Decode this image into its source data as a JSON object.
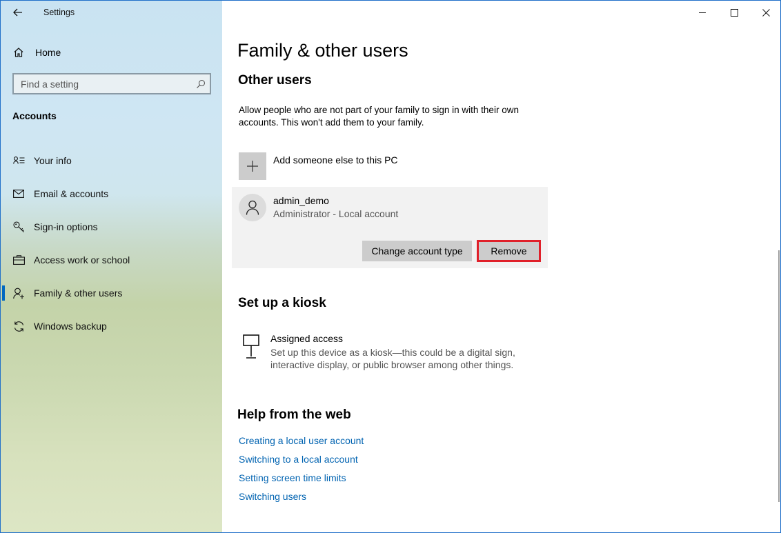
{
  "window": {
    "title": "Settings"
  },
  "sidebar": {
    "home_label": "Home",
    "search": {
      "placeholder": "Find a setting"
    },
    "section_title": "Accounts",
    "items": [
      {
        "label": "Your info",
        "icon": "contact-card-icon"
      },
      {
        "label": "Email & accounts",
        "icon": "mail-icon"
      },
      {
        "label": "Sign-in options",
        "icon": "key-icon"
      },
      {
        "label": "Access work or school",
        "icon": "briefcase-icon"
      },
      {
        "label": "Family & other users",
        "icon": "add-person-icon",
        "active": true
      },
      {
        "label": "Windows backup",
        "icon": "sync-icon"
      }
    ]
  },
  "main": {
    "page_title": "Family & other users",
    "other_users": {
      "heading": "Other users",
      "description": "Allow people who are not part of your family to sign in with their own accounts. This won't add them to your family.",
      "add_label": "Add someone else to this PC",
      "user": {
        "name": "admin_demo",
        "subtitle": "Administrator - Local account"
      },
      "change_type_label": "Change account type",
      "remove_label": "Remove"
    },
    "kiosk": {
      "heading": "Set up a kiosk",
      "title": "Assigned access",
      "description": "Set up this device as a kiosk—this could be a digital sign, interactive display, or public browser among other things."
    },
    "help": {
      "heading": "Help from the web",
      "links": [
        "Creating a local user account",
        "Switching to a local account",
        "Setting screen time limits",
        "Switching users"
      ]
    }
  },
  "colors": {
    "accent": "#0067c0",
    "link": "#0063b1",
    "highlight": "#e0202a"
  }
}
